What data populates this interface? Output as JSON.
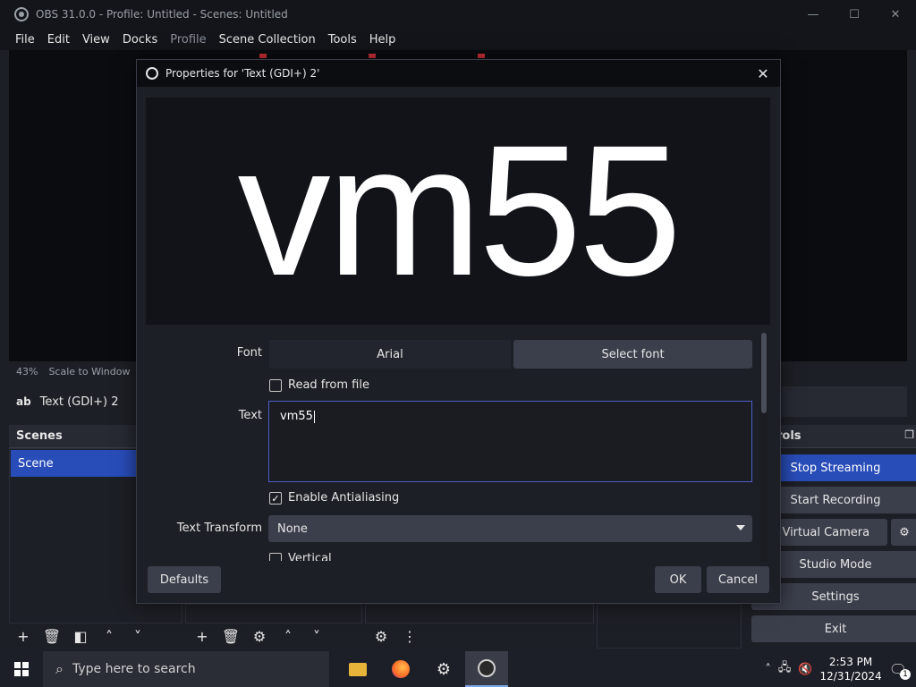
{
  "window": {
    "title": "OBS 31.0.0 - Profile: Untitled - Scenes: Untitled",
    "controls": {
      "minimize": "—",
      "maximize": "☐",
      "close": "✕"
    }
  },
  "menu": [
    "File",
    "Edit",
    "View",
    "Docks",
    "Profile",
    "Scene Collection",
    "Tools",
    "Help"
  ],
  "preview_status": {
    "zoom": "43%",
    "scale_mode": "Scale to Window"
  },
  "selected_source": {
    "icon": "ab",
    "name": "Text (GDI+) 2"
  },
  "scenes_dock": {
    "title": "Scenes",
    "items": [
      "Scene"
    ]
  },
  "controls_dock": {
    "title_partial": "rols",
    "buttons": [
      "Stop Streaming",
      "Start Recording",
      "rt Virtual Camera",
      "Studio Mode",
      "Settings",
      "Exit"
    ]
  },
  "dialog": {
    "title": "Properties for 'Text (GDI+) 2'",
    "preview_text": "vm55",
    "font_label": "Font",
    "font_value": "Arial",
    "select_font_label": "Select font",
    "read_from_file_label": "Read from file",
    "read_from_file_checked": false,
    "text_label": "Text",
    "text_value": "vm55",
    "antialias_label": "Enable Antialiasing",
    "antialias_checked": true,
    "text_transform_label": "Text Transform",
    "text_transform_value": "None",
    "partial_option": "Vertical",
    "defaults_label": "Defaults",
    "ok_label": "OK",
    "cancel_label": "Cancel"
  },
  "taskbar": {
    "search_placeholder": "Type here to search",
    "apps": [
      "file-explorer-icon",
      "firefox-icon",
      "settings-icon",
      "obs-icon"
    ],
    "time": "2:53 PM",
    "date": "12/31/2024",
    "notification_count": "1"
  }
}
